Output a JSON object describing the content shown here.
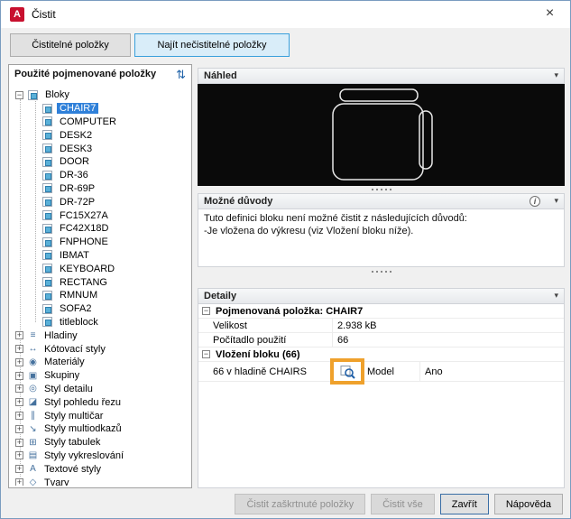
{
  "window": {
    "title": "Čistit"
  },
  "tabs": [
    {
      "label": "Čistitelné položky"
    },
    {
      "label": "Najít nečistitelné položky"
    }
  ],
  "left_panel": {
    "header": "Použité pojmenované položky",
    "tree": {
      "root": "Bloky",
      "selected": "CHAIR7",
      "blocks": [
        "CHAIR7",
        "COMPUTER",
        "DESK2",
        "DESK3",
        "DOOR",
        "DR-36",
        "DR-69P",
        "DR-72P",
        "FC15X27A",
        "FC42X18D",
        "FNPHONE",
        "IBMAT",
        "KEYBOARD",
        "RECTANG",
        "RMNUM",
        "SOFA2",
        "titleblock"
      ],
      "categories": [
        "Hladiny",
        "Kótovací styly",
        "Materiály",
        "Skupiny",
        "Styl detailu",
        "Styl pohledu řezu",
        "Styly multičar",
        "Styly multiodkazů",
        "Styly tabulek",
        "Styly vykreslování",
        "Textové styly",
        "Tvary"
      ]
    }
  },
  "preview": {
    "header": "Náhled"
  },
  "reasons": {
    "header": "Možné důvody",
    "line1": "Tuto definici bloku není možné čistit z následujících důvodů:",
    "line2": "-Je vložena do výkresu (viz Vložení bloku níže)."
  },
  "details": {
    "header": "Detaily",
    "group_item": "Pojmenovaná položka: CHAIR7",
    "rows": [
      {
        "label": "Velikost",
        "value": "2.938 kB"
      },
      {
        "label": "Počítadlo použití",
        "value": "66"
      }
    ],
    "group_insert": "Vložení bloku (66)",
    "insert": {
      "label": "66 v hladině CHAIRS",
      "space": "Model",
      "flag": "Ano"
    }
  },
  "footer": {
    "purge_checked": "Čistit zaškrtnuté položky",
    "purge_all": "Čistit vše",
    "close": "Zavřít",
    "help": "Nápověda"
  },
  "colors": {
    "accent": "#3aa0dc",
    "selection": "#2f80d9",
    "annotation": "#efa12c",
    "preview_bg": "#0a0a0a",
    "autocad_red": "#c8102e"
  }
}
